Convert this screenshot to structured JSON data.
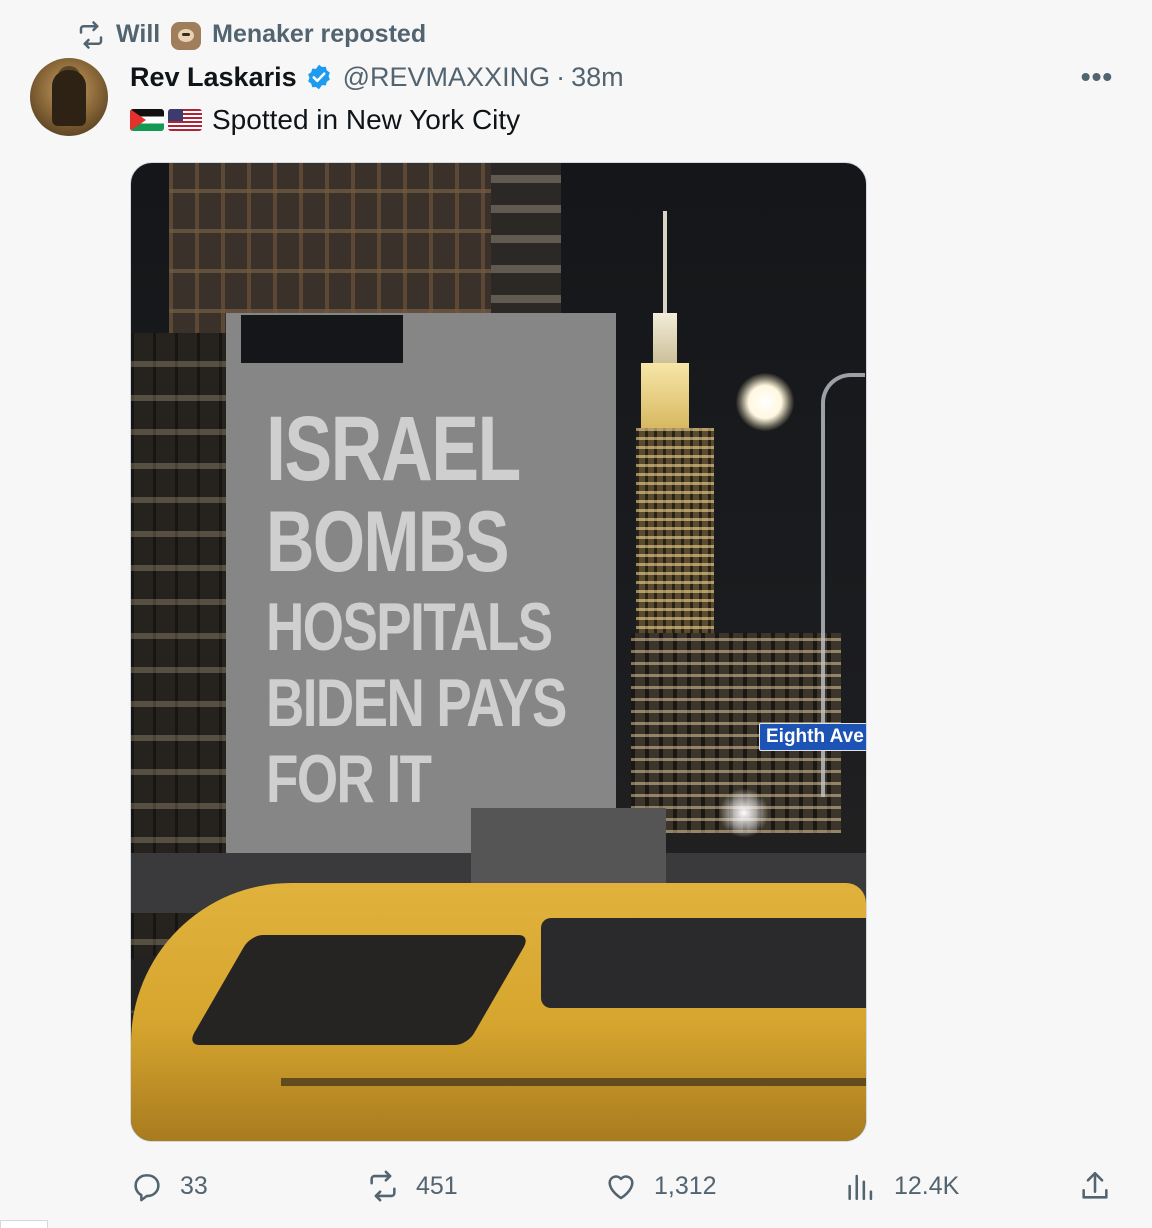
{
  "repost": {
    "icon": "repost-icon",
    "user_prefix": "Will",
    "user_suffix": "Menaker reposted"
  },
  "author": {
    "display_name": "Rev Laskaris",
    "verified": true,
    "handle": "@REVMAXXING",
    "separator": "·",
    "time": "38m"
  },
  "more_label": "•••",
  "tweet": {
    "flags": [
      "palestine-flag",
      "us-flag"
    ],
    "text": "Spotted in New York City"
  },
  "media": {
    "billboard_lines": [
      "ISRAEL",
      "BOMBS",
      "HOSPITALS",
      "BIDEN PAYS",
      "FOR IT"
    ],
    "street_sign": "Eighth Ave"
  },
  "actions": {
    "replies": "33",
    "reposts": "451",
    "likes": "1,312",
    "views": "12.4K"
  },
  "colors": {
    "text": "#0f1419",
    "secondary": "#536471",
    "verified": "#1d9bf0",
    "background": "#f7f7f7"
  }
}
